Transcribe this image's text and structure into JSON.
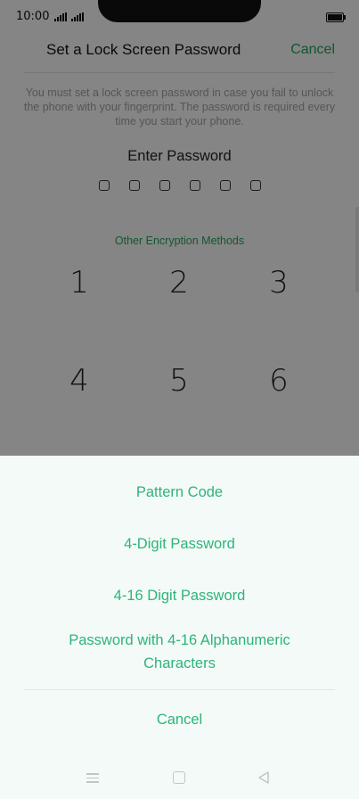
{
  "status_bar": {
    "time": "10:00"
  },
  "header": {
    "title": "Set a Lock Screen Password",
    "cancel_label": "Cancel"
  },
  "info_text": "You must set a lock screen password in case you fail to unlock the phone with your fingerprint. The password is required every time you start your phone.",
  "enter_password_label": "Enter Password",
  "password_dots_count": 6,
  "other_methods_label": "Other Encryption Methods",
  "keypad": {
    "keys": [
      "1",
      "2",
      "3",
      "4",
      "5",
      "6"
    ]
  },
  "sheet": {
    "options": [
      "Pattern Code",
      "4-Digit Password",
      "4-16 Digit Password",
      "Password with 4-16 Alphanumeric Characters"
    ],
    "cancel_label": "Cancel"
  },
  "colors": {
    "accent": "#2db47a",
    "scrim": "rgba(0,0,0,0.45)",
    "sheet_bg": "#f4faf8"
  },
  "icons": {
    "nav_menu": "menu-icon",
    "nav_home": "home-icon",
    "nav_back": "back-icon"
  }
}
